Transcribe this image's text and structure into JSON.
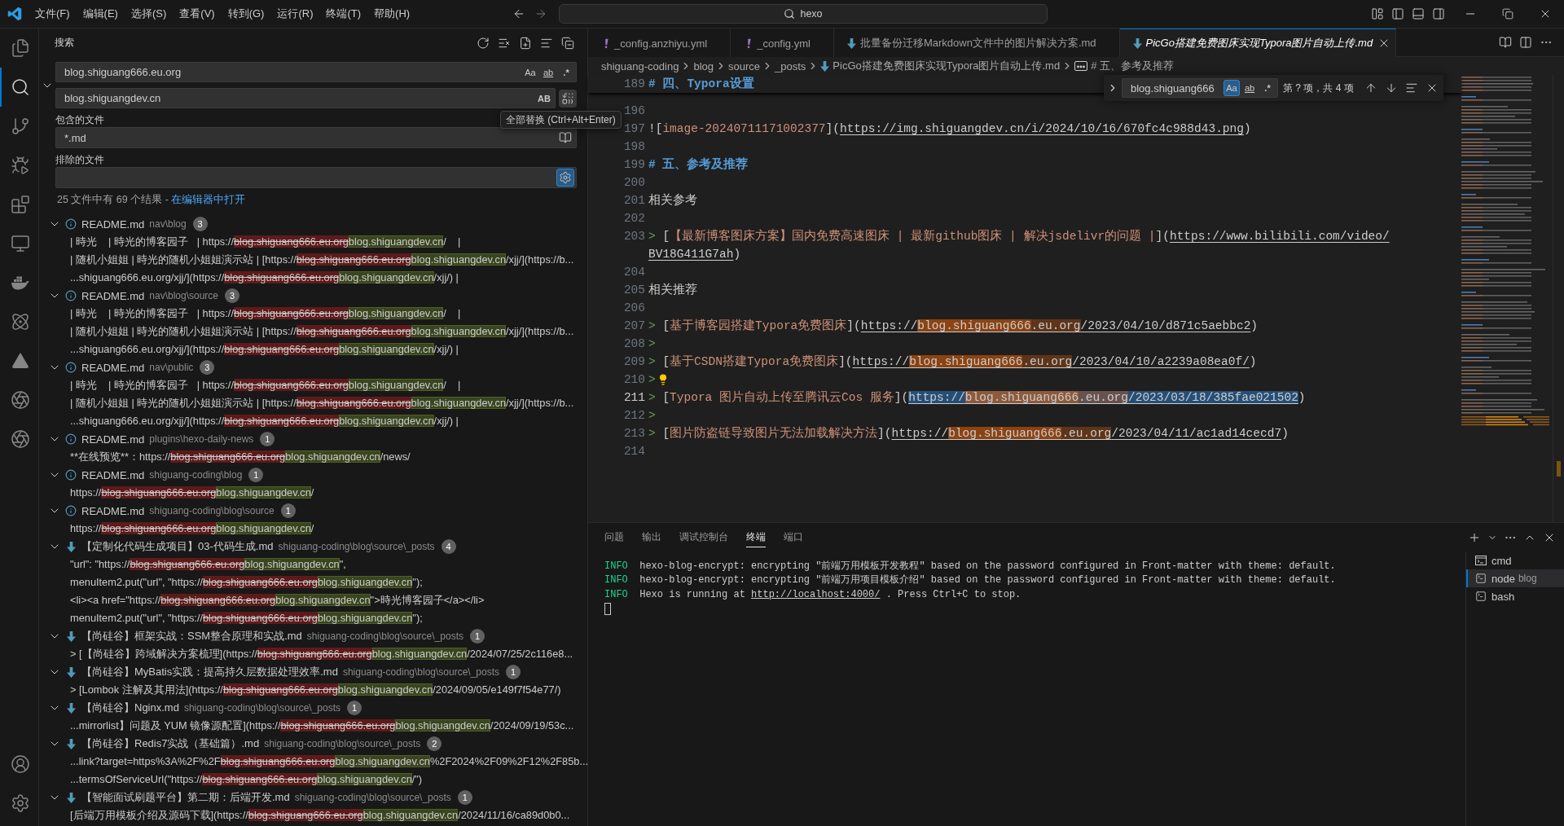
{
  "titlebar": {
    "menu": [
      "文件(F)",
      "编辑(E)",
      "选择(S)",
      "查看(V)",
      "转到(G)",
      "运行(R)",
      "终端(T)",
      "帮助(H)"
    ],
    "command_center": "hexo"
  },
  "activity_bar": {
    "items": [
      {
        "kind": "explorer",
        "selected": false
      },
      {
        "kind": "search",
        "selected": true
      },
      {
        "kind": "source_control",
        "selected": false
      },
      {
        "kind": "run",
        "selected": false
      },
      {
        "kind": "extensions",
        "selected": false
      },
      {
        "kind": "remote",
        "selected": false
      },
      {
        "kind": "docker",
        "selected": false
      },
      {
        "kind": "atom",
        "selected": false
      },
      {
        "kind": "cone",
        "selected": false
      },
      {
        "kind": "aperture",
        "selected": false
      },
      {
        "kind": "aperture",
        "selected": false
      }
    ]
  },
  "sidebar": {
    "title": "搜索",
    "search": {
      "value": "blog.shiguang666.eu.org",
      "toggles": [
        {
          "kind": "case",
          "label": "Aa",
          "selected": false
        },
        {
          "kind": "word",
          "label": "ab",
          "selected": false
        },
        {
          "kind": "regex",
          "label": ".*",
          "selected": false
        }
      ]
    },
    "replace": {
      "value": "blog.shiguangdev.cn",
      "toggles": [
        {
          "kind": "preserve_case",
          "label": "AB",
          "selected": false
        }
      ],
      "tooltip": "全部替换 (Ctrl+Alt+Enter)"
    },
    "include": {
      "label": "包含的文件",
      "value": "*.md",
      "toggle_selected": false
    },
    "exclude": {
      "label": "排除的文件",
      "toggle_selected": true
    },
    "summary": {
      "text": "25 文件中有 69 个结果 - ",
      "link": "在编辑器中打开"
    },
    "results": [
      {
        "kind": "readme",
        "name": "README.md",
        "path": "nav\\blog",
        "count": "3",
        "expanded": true,
        "matches": [
          {
            "before": "| 時光    | 時光的博客园子   | https://",
            "removed": "blog.shiguang666.eu.org",
            "added": "blog.shiguangdev.cn",
            "after": "/    |"
          },
          {
            "before": "| 随机小姐姐 | 時光的随机小姐姐演示站 | [https://",
            "removed": "blog.shiguang666.eu.org",
            "added": "blog.shiguangdev.cn",
            "after": "/xjj/](https://b..."
          },
          {
            "before": "...shiguang666.eu.org/xjj/](https://",
            "removed": "blog.shiguang666.eu.org",
            "added": "blog.shiguangdev.cn",
            "after": "/xjj/) |"
          }
        ]
      },
      {
        "kind": "readme",
        "name": "README.md",
        "path": "nav\\blog\\source",
        "count": "3",
        "expanded": true,
        "matches": [
          {
            "before": "| 時光    | 時光的博客园子   | https://",
            "removed": "blog.shiguang666.eu.org",
            "added": "blog.shiguangdev.cn",
            "after": "/    |"
          },
          {
            "before": "| 随机小姐姐 | 時光的随机小姐姐演示站 | [https://",
            "removed": "blog.shiguang666.eu.org",
            "added": "blog.shiguangdev.cn",
            "after": "/xjj/](https://b..."
          },
          {
            "before": "...shiguang666.eu.org/xjj/](https://",
            "removed": "blog.shiguang666.eu.org",
            "added": "blog.shiguangdev.cn",
            "after": "/xjj/) |"
          }
        ]
      },
      {
        "kind": "readme",
        "name": "README.md",
        "path": "nav\\public",
        "count": "3",
        "expanded": true,
        "matches": [
          {
            "before": "| 時光    | 時光的博客园子   | https://",
            "removed": "blog.shiguang666.eu.org",
            "added": "blog.shiguangdev.cn",
            "after": "/    |"
          },
          {
            "before": "| 随机小姐姐 | 時光的随机小姐姐演示站 | [https://",
            "removed": "blog.shiguang666.eu.org",
            "added": "blog.shiguangdev.cn",
            "after": "/xjj/](https://b..."
          },
          {
            "before": "...shiguang666.eu.org/xjj/](https://",
            "removed": "blog.shiguang666.eu.org",
            "added": "blog.shiguangdev.cn",
            "after": "/xjj/) |"
          }
        ]
      },
      {
        "kind": "readme",
        "name": "README.md",
        "path": "plugins\\hexo-daily-news",
        "count": "1",
        "expanded": true,
        "matches": [
          {
            "before": "**在线预览**：https://",
            "removed": "blog.shiguang666.eu.org",
            "added": "blog.shiguangdev.cn",
            "after": "/news/"
          }
        ]
      },
      {
        "kind": "readme",
        "name": "README.md",
        "path": "shiguang-coding\\blog",
        "count": "1",
        "expanded": true,
        "matches": [
          {
            "before": "https://",
            "removed": "blog.shiguang666.eu.org",
            "added": "blog.shiguangdev.cn",
            "after": "/"
          }
        ]
      },
      {
        "kind": "readme",
        "name": "README.md",
        "path": "shiguang-coding\\blog\\source",
        "count": "1",
        "expanded": true,
        "matches": [
          {
            "before": "https://",
            "removed": "blog.shiguang666.eu.org",
            "added": "blog.shiguangdev.cn",
            "after": "/"
          }
        ]
      },
      {
        "kind": "markdown",
        "name": "【定制化代码生成项目】03-代码生成.md",
        "path": "shiguang-coding\\blog\\source\\_posts",
        "count": "4",
        "expanded": true,
        "matches": [
          {
            "before": "\"url\": \"https://",
            "removed": "blog.shiguang666.eu.org",
            "added": "blog.shiguangdev.cn",
            "after": "\","
          },
          {
            "before": "menuItem2.put(\"url\", \"https://",
            "removed": "blog.shiguang666.eu.org",
            "added": "blog.shiguangdev.cn",
            "after": "\");"
          },
          {
            "before": "<li><a href=\"https://",
            "removed": "blog.shiguang666.eu.org",
            "added": "blog.shiguangdev.cn",
            "after": "\">時光博客园子</a></li>"
          },
          {
            "before": "menuItem2.put(\"url\", \"https://",
            "removed": "blog.shiguang666.eu.org",
            "added": "blog.shiguangdev.cn",
            "after": "\");"
          }
        ]
      },
      {
        "kind": "markdown",
        "name": "【尚硅谷】框架实战：SSM整合原理和实战.md",
        "path": "shiguang-coding\\blog\\source\\_posts",
        "count": "1",
        "expanded": true,
        "matches": [
          {
            "before": "> [【尚硅谷】跨域解决方案梳理](https://",
            "removed": "blog.shiguang666.eu.org",
            "added": "blog.shiguangdev.cn",
            "after": "/2024/07/25/2c116e8..."
          }
        ]
      },
      {
        "kind": "markdown",
        "name": "【尚硅谷】MyBatis实践：提高持久层数据处理效率.md",
        "path": "shiguang-coding\\blog\\source\\_posts",
        "count": "1",
        "expanded": true,
        "matches": [
          {
            "before": "> [Lombok 注解及其用法](https://",
            "removed": "blog.shiguang666.eu.org",
            "added": "blog.shiguangdev.cn",
            "after": "/2024/09/05/e149f7f54e77/)"
          }
        ]
      },
      {
        "kind": "markdown",
        "name": "【尚硅谷】Nginx.md",
        "path": "shiguang-coding\\blog\\source\\_posts",
        "count": "1",
        "expanded": true,
        "matches": [
          {
            "before": "...mirrorlist】问题及 YUM 镜像源配置](https://",
            "removed": "blog.shiguang666.eu.org",
            "added": "blog.shiguangdev.cn",
            "after": "/2024/09/19/53c..."
          }
        ]
      },
      {
        "kind": "markdown",
        "name": "【尚硅谷】Redis7实战（基础篇）.md",
        "path": "shiguang-coding\\blog\\source\\_posts",
        "count": "2",
        "expanded": true,
        "matches": [
          {
            "before": "...link?target=https%3A%2F%2F",
            "removed": "blog.shiguang666.eu.org",
            "added": "blog.shiguangdev.cn",
            "after": "%2F2024%2F09%2F12%2F85b..."
          },
          {
            "before": "...termsOfServiceUrl(\"https://",
            "removed": "blog.shiguang666.eu.org",
            "added": "blog.shiguangdev.cn",
            "after": "/\")"
          }
        ]
      },
      {
        "kind": "markdown",
        "name": "【智能面试刷题平台】第二期：后端开发.md",
        "path": "shiguang-coding\\blog\\source\\_posts",
        "count": "1",
        "expanded": true,
        "matches": [
          {
            "before": "[后端万用模板介绍及源码下载](https://",
            "removed": "blog.shiguang666.eu.org",
            "added": "blog.shiguangdev.cn",
            "after": "/2024/11/16/ca89d0b0..."
          }
        ]
      }
    ]
  },
  "editor": {
    "tabs": [
      {
        "kind": "yaml",
        "label": "_config.anzhiyu.yml",
        "selected": false,
        "preview": false
      },
      {
        "kind": "yaml",
        "label": "_config.yml",
        "selected": false,
        "preview": false
      },
      {
        "kind": "markdown",
        "label": "批量备份迁移Markdown文件中的图片解决方案.md",
        "selected": false,
        "preview": false
      },
      {
        "kind": "markdown",
        "label": "PicGo搭建免费图床实现Typora图片自动上传.md",
        "selected": true,
        "preview": true
      }
    ],
    "breadcrumbs": [
      {
        "kind": "folder",
        "label": "shiguang-coding"
      },
      {
        "kind": "folder",
        "label": "blog"
      },
      {
        "kind": "folder",
        "label": "source"
      },
      {
        "kind": "folder",
        "label": "_posts"
      },
      {
        "kind": "file",
        "label": "PicGo搭建免费图床实现Typora图片自动上传.md"
      },
      {
        "kind": "symbol",
        "label": "# 五、参考及推荐"
      }
    ],
    "sticky_line": {
      "number": "189",
      "segments": [
        {
          "kind": "heading",
          "text": "# 四、Typora设置"
        }
      ]
    },
    "lines": [
      {
        "number": "196",
        "current": false
      },
      {
        "number": "197",
        "current": false,
        "segments": [
          {
            "kind": "punct",
            "text": "!["
          },
          {
            "kind": "link_text",
            "text": "image-20240711171002377"
          },
          {
            "kind": "punct",
            "text": "]("
          },
          {
            "kind": "url",
            "text": "https://img.shiguangdev.cn/i/2024/10/16/670fc4c988d43.png"
          },
          {
            "kind": "punct",
            "text": ")"
          }
        ]
      },
      {
        "number": "198",
        "current": false
      },
      {
        "number": "199",
        "current": false,
        "segments": [
          {
            "kind": "heading",
            "text": "# 五、参考及推荐"
          }
        ]
      },
      {
        "number": "200",
        "current": false
      },
      {
        "number": "201",
        "current": false,
        "segments": [
          {
            "kind": "plain",
            "text": "相关参考"
          }
        ]
      },
      {
        "number": "202",
        "current": false
      },
      {
        "number": "203",
        "current": false,
        "segments": [
          {
            "kind": "quote",
            "text": ">"
          },
          {
            "kind": "punct",
            "text": " ["
          },
          {
            "kind": "link_text",
            "text": "【最新博客图床方案】国内免费高速图床 | 最新github图床 | 解决jsdelivr的问题 |"
          },
          {
            "kind": "punct",
            "text": "]("
          },
          {
            "kind": "url",
            "text": "https://www.bilibili.com/video/"
          }
        ],
        "wrap": [
          {
            "kind": "url",
            "text": "BV18G411G7ah"
          },
          {
            "kind": "punct",
            "text": ")"
          }
        ]
      },
      {
        "number": "204",
        "current": false
      },
      {
        "number": "205",
        "current": false,
        "segments": [
          {
            "kind": "plain",
            "text": "相关推荐"
          }
        ]
      },
      {
        "number": "206",
        "current": false
      },
      {
        "number": "207",
        "current": false,
        "segments": [
          {
            "kind": "quote",
            "text": ">"
          },
          {
            "kind": "punct",
            "text": " ["
          },
          {
            "kind": "link_text",
            "text": "基于博客园搭建Typora免费图床"
          },
          {
            "kind": "punct",
            "text": "]("
          },
          {
            "kind": "url",
            "text": "https://"
          },
          {
            "kind": "match",
            "text": "blog.shiguang666"
          },
          {
            "kind": "result",
            "text": ".eu.org"
          },
          {
            "kind": "url",
            "text": "/2023/04/10/d871c5aebbc2"
          },
          {
            "kind": "punct",
            "text": ")"
          }
        ]
      },
      {
        "number": "208",
        "current": false,
        "segments": [
          {
            "kind": "quote",
            "text": ">"
          }
        ]
      },
      {
        "number": "209",
        "current": false,
        "segments": [
          {
            "kind": "quote",
            "text": ">"
          },
          {
            "kind": "punct",
            "text": " ["
          },
          {
            "kind": "link_text",
            "text": "基于CSDN搭建Typora免费图床"
          },
          {
            "kind": "punct",
            "text": "]("
          },
          {
            "kind": "url",
            "text": "https://"
          },
          {
            "kind": "match",
            "text": "blog.shiguang666"
          },
          {
            "kind": "result",
            "text": ".eu.org"
          },
          {
            "kind": "url",
            "text": "/2023/04/10/a2239a08ea0f/"
          },
          {
            "kind": "punct",
            "text": ")"
          }
        ]
      },
      {
        "number": "210",
        "current": false,
        "segments": [
          {
            "kind": "quote",
            "text": ">"
          },
          {
            "kind": "lightbulb"
          }
        ]
      },
      {
        "number": "211",
        "current": true,
        "segments": [
          {
            "kind": "quote",
            "text": ">"
          },
          {
            "kind": "punct",
            "text": " ["
          },
          {
            "kind": "link_text",
            "text": "Typora 图片自动上传至腾讯云Cos 服务"
          },
          {
            "kind": "punct",
            "text": "]("
          },
          {
            "kind": "selection",
            "text": "https://"
          },
          {
            "kind": "selected_match",
            "text": "blog.shiguang666"
          },
          {
            "kind": "selected_result",
            "text": ".eu.org"
          },
          {
            "kind": "selection",
            "text": "/2023/03/18/385fae021502"
          },
          {
            "kind": "punct",
            "text": ")"
          }
        ]
      },
      {
        "number": "212",
        "current": false,
        "segments": [
          {
            "kind": "quote",
            "text": ">"
          }
        ]
      },
      {
        "number": "213",
        "current": false,
        "segments": [
          {
            "kind": "quote",
            "text": ">"
          },
          {
            "kind": "punct",
            "text": " ["
          },
          {
            "kind": "link_text",
            "text": "图片防盗链导致图片无法加载解决方法"
          },
          {
            "kind": "punct",
            "text": "]("
          },
          {
            "kind": "url",
            "text": "https://"
          },
          {
            "kind": "match",
            "text": "blog.shiguang666"
          },
          {
            "kind": "result",
            "text": ".eu.org"
          },
          {
            "kind": "url",
            "text": "/2023/04/11/ac1ad14cecd7"
          },
          {
            "kind": "punct",
            "text": ")"
          }
        ]
      },
      {
        "number": "214",
        "current": false
      }
    ],
    "find": {
      "value": "blog.shiguang666",
      "toggles": [
        {
          "kind": "case",
          "label": "Aa",
          "selected": true
        },
        {
          "kind": "word",
          "label": "ab",
          "selected": false
        },
        {
          "kind": "regex",
          "label": ".*",
          "selected": false
        }
      ],
      "count": "第 ? 项，共 4 项"
    }
  },
  "panel": {
    "tabs": [
      {
        "label": "问题",
        "selected": false
      },
      {
        "label": "输出",
        "selected": false
      },
      {
        "label": "调试控制台",
        "selected": false
      },
      {
        "label": "终端",
        "selected": true
      },
      {
        "label": "端口",
        "selected": false
      }
    ],
    "terminal": {
      "lines": [
        {
          "tag": "INFO",
          "text": "hexo-blog-encrypt: encrypting \"前端万用模板开发教程\" based on the password configured in Front-matter with theme: default."
        },
        {
          "tag": "INFO",
          "text": "hexo-blog-encrypt: encrypting \"前端万用项目模板介绍\" based on the password configured in Front-matter with theme: default."
        },
        {
          "tag": "INFO",
          "text": "Hexo is running at ",
          "link": "http://localhost:4000/",
          "after": " . Press Ctrl+C to stop."
        }
      ],
      "sessions": [
        {
          "kind": "cmd",
          "name": "cmd",
          "selected": false
        },
        {
          "kind": "shell",
          "name": "node",
          "description": "blog",
          "selected": true
        },
        {
          "kind": "shell",
          "name": "bash",
          "selected": false
        }
      ]
    }
  }
}
